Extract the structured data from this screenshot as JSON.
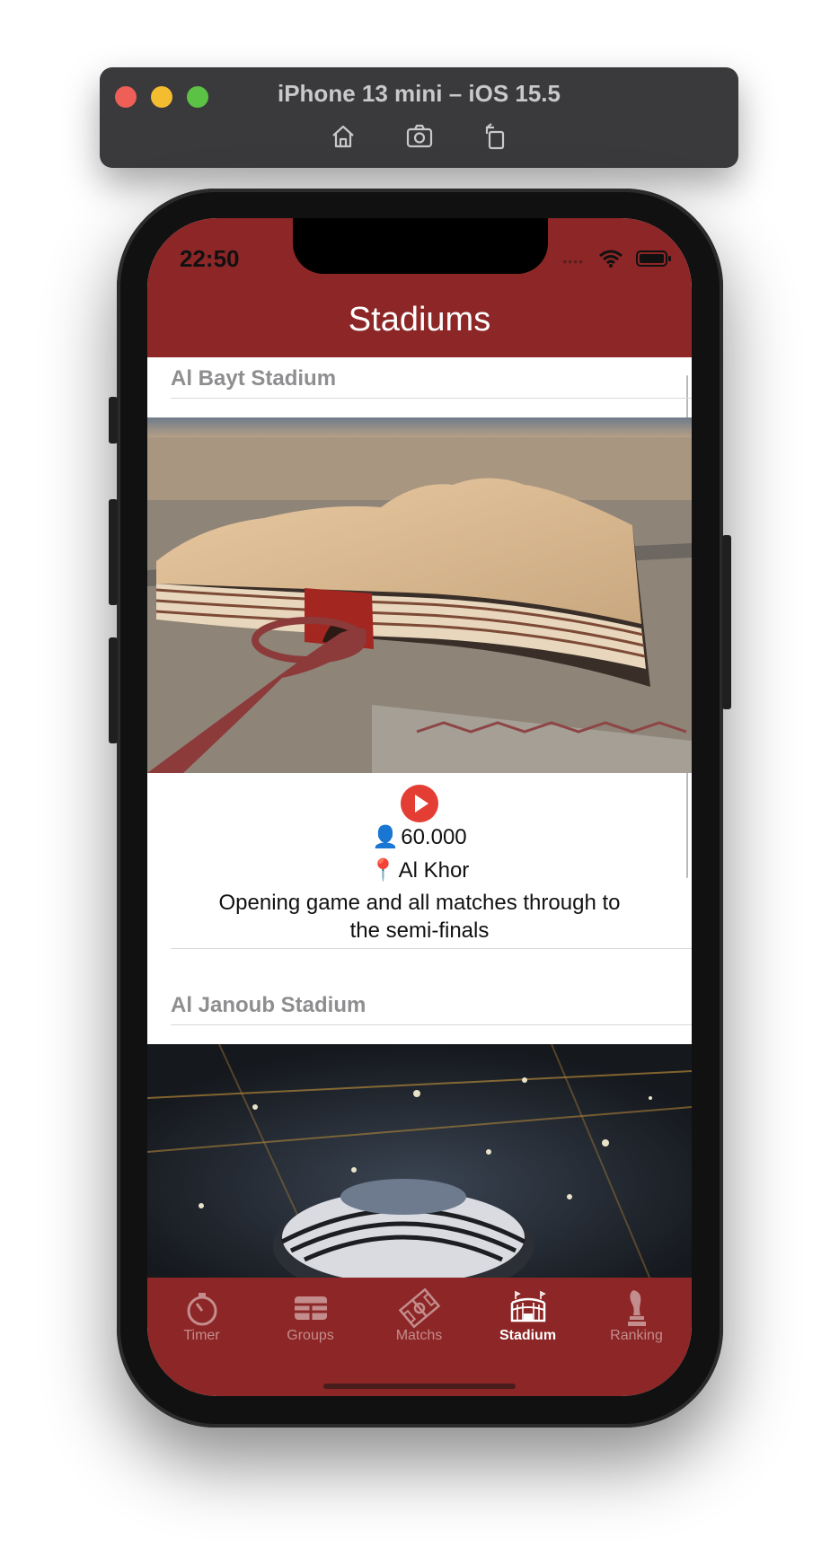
{
  "simulator": {
    "title": "iPhone 13 mini – iOS 15.5",
    "tools": [
      "home-icon",
      "screenshot-icon",
      "rotate-icon"
    ]
  },
  "status_bar": {
    "time": "22:50"
  },
  "nav": {
    "title": "Stadiums"
  },
  "stadiums": [
    {
      "name": "Al Bayt Stadium",
      "capacity": "60.000",
      "location": "Al Khor",
      "description": "Opening game and all matches through to the semi-finals"
    },
    {
      "name": "Al Janoub Stadium"
    }
  ],
  "tabs": [
    {
      "label": "Timer",
      "icon": "timer-icon",
      "active": false
    },
    {
      "label": "Groups",
      "icon": "groups-icon",
      "active": false
    },
    {
      "label": "Matchs",
      "icon": "pitch-icon",
      "active": false
    },
    {
      "label": "Stadium",
      "icon": "stadium-icon",
      "active": true
    },
    {
      "label": "Ranking",
      "icon": "trophy-icon",
      "active": false
    }
  ],
  "colors": {
    "brand": "#8d2626",
    "play": "#e43e34"
  }
}
